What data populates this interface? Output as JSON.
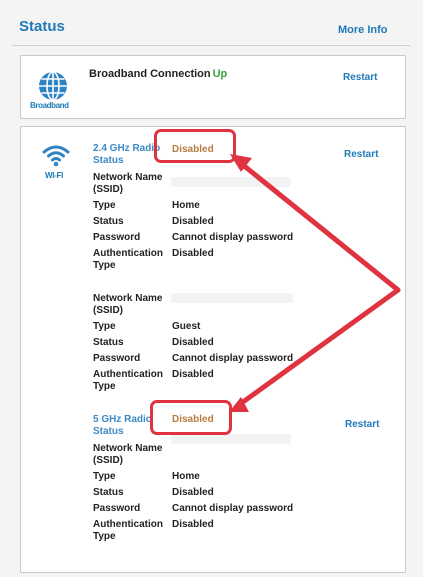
{
  "header": {
    "title": "Status",
    "more_info": "More Info"
  },
  "broadband": {
    "icon_label": "Broadband",
    "name": "Broadband Connection",
    "state": "Up",
    "restart": "Restart"
  },
  "wifi": {
    "icon_label": "WI-FI",
    "restart_24": "Restart",
    "restart_5": "Restart",
    "radio_24": {
      "name": "2.4 GHz Radio Status",
      "state": "Disabled"
    },
    "radio_5": {
      "name": "5 GHz Radio Status",
      "state": "Disabled"
    },
    "net1": {
      "ssid_label": "Network Name (SSID)",
      "type_label": "Type",
      "type": "Home",
      "status_label": "Status",
      "status": "Disabled",
      "password_label": "Password",
      "password": "Cannot display password",
      "auth_label": "Authentication Type",
      "auth": "Disabled"
    },
    "net2": {
      "ssid_label": "Network Name (SSID)",
      "type_label": "Type",
      "type": "Guest",
      "status_label": "Status",
      "status": "Disabled",
      "password_label": "Password",
      "password": "Cannot display password",
      "auth_label": "Authentication Type",
      "auth": "Disabled"
    },
    "net3": {
      "ssid_label": "Network Name (SSID)",
      "type_label": "Type",
      "type": "Home",
      "status_label": "Status",
      "status": "Disabled",
      "password_label": "Password",
      "password": "Cannot display password",
      "auth_label": "Authentication Type",
      "auth": "Disabled"
    }
  },
  "colors": {
    "accent": "#1f79b8",
    "up": "#3aa23a",
    "disabled": "#b87c3f",
    "annotation": "#e03340"
  }
}
